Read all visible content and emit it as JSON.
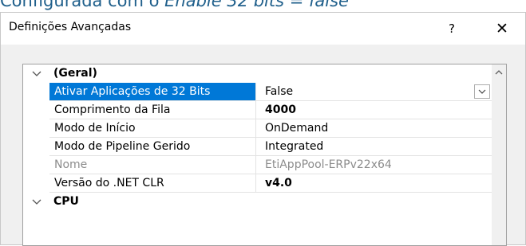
{
  "caption": {
    "prefix": "Configurada com o ",
    "italic": "Enable 32 bits = false"
  },
  "window": {
    "title": "Definições Avançadas",
    "help_label": "?",
    "close_label": "✕"
  },
  "icons": {
    "help": "help-icon",
    "close": "close-icon",
    "expand": "chevron-down-icon",
    "dropdown": "chevron-down-icon",
    "scroll_up": "chevron-up-icon"
  },
  "colors": {
    "selection": "#0078d7",
    "caption": "#1f5f8b",
    "disabled": "#8c8c8c"
  },
  "grid": {
    "category_general": "(Geral)",
    "rows": [
      {
        "name": "Ativar Aplicações de 32 Bits",
        "value": "False"
      },
      {
        "name": "Comprimento da Fila",
        "value": "4000"
      },
      {
        "name": "Modo de Início",
        "value": "OnDemand"
      },
      {
        "name": "Modo de Pipeline Gerido",
        "value": "Integrated"
      },
      {
        "name": "Nome",
        "value": "EtiAppPool-ERPv22x64"
      },
      {
        "name": "Versão do .NET CLR",
        "value": "v4.0"
      }
    ],
    "category_cpu": "CPU"
  }
}
